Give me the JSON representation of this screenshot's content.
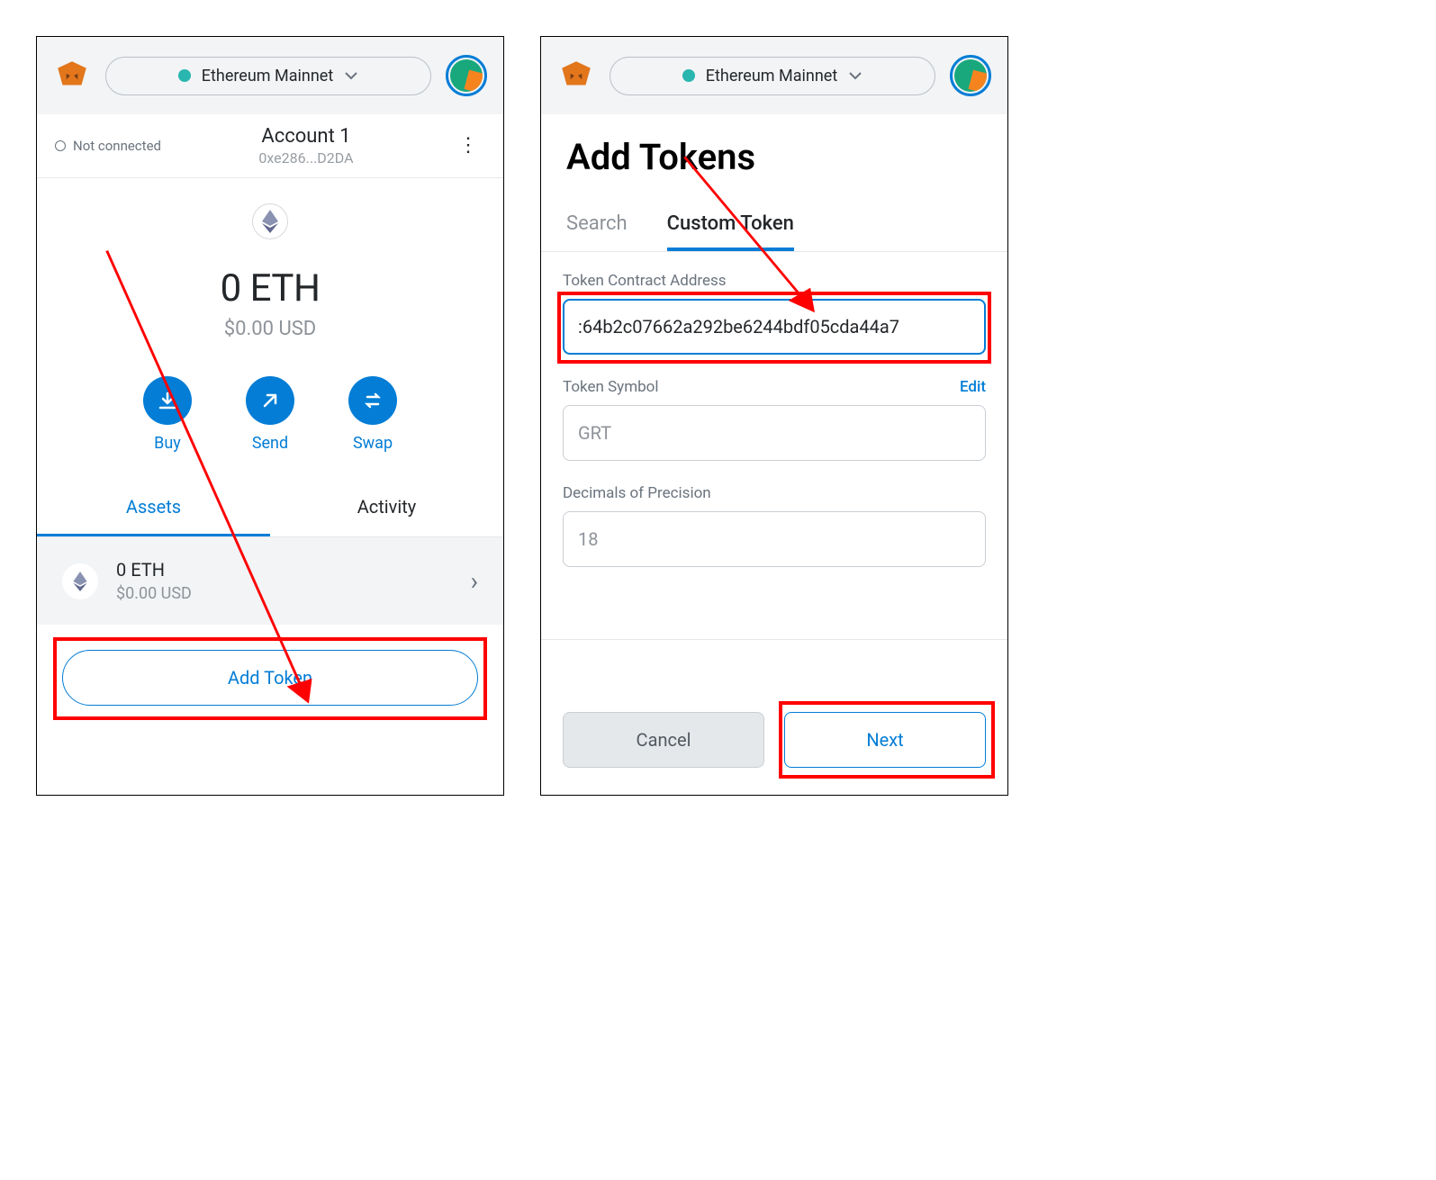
{
  "left": {
    "network": "Ethereum Mainnet",
    "not_connected": "Not connected",
    "account_name": "Account 1",
    "account_address": "0xe286...D2DA",
    "balance": "0 ETH",
    "fiat": "$0.00 USD",
    "actions": {
      "buy": "Buy",
      "send": "Send",
      "swap": "Swap"
    },
    "tabs": {
      "assets": "Assets",
      "activity": "Activity"
    },
    "asset": {
      "amount": "0 ETH",
      "fiat": "$0.00 USD"
    },
    "add_token": "Add Token"
  },
  "right": {
    "network": "Ethereum Mainnet",
    "title": "Add Tokens",
    "tabs": {
      "search": "Search",
      "custom": "Custom Token"
    },
    "labels": {
      "address": "Token Contract Address",
      "symbol": "Token Symbol",
      "edit": "Edit",
      "decimals": "Decimals of Precision"
    },
    "values": {
      "address": ":64b2c07662a292be6244bdf05cda44a7",
      "symbol": "GRT",
      "decimals": "18"
    },
    "buttons": {
      "cancel": "Cancel",
      "next": "Next"
    }
  }
}
